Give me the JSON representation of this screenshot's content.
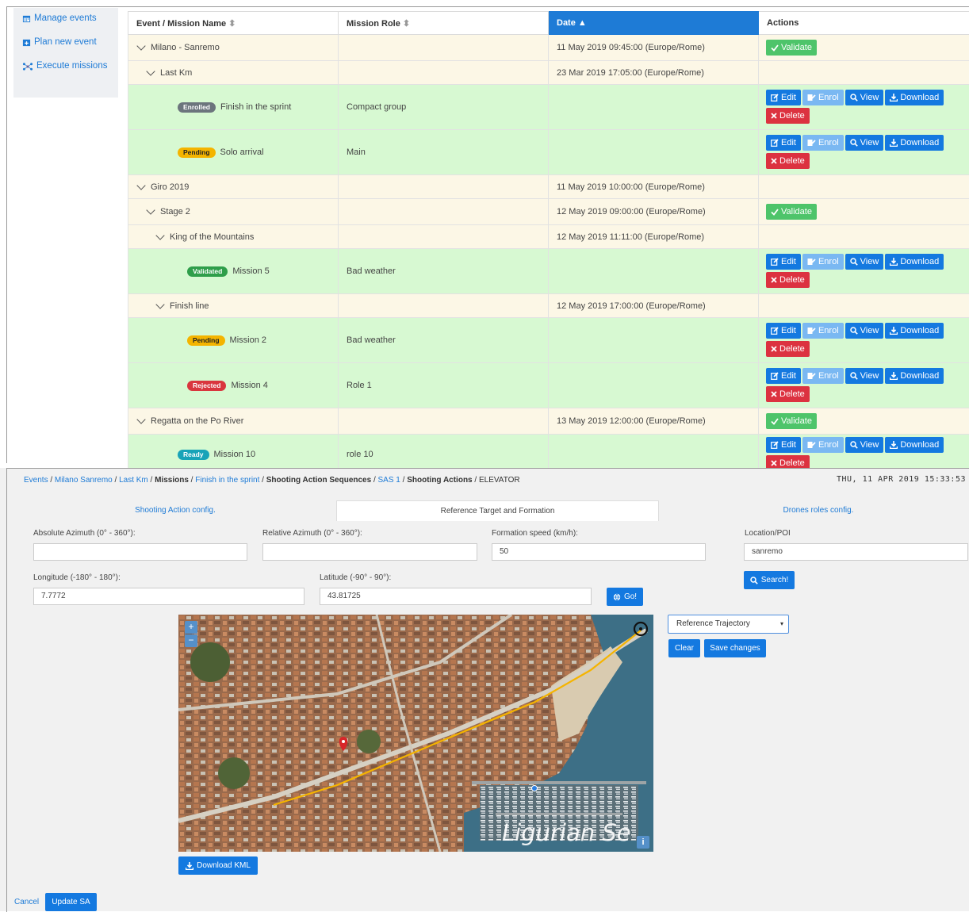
{
  "sidebar": {
    "items": [
      {
        "label": "Manage events",
        "icon": "calendar-icon"
      },
      {
        "label": "Plan new event",
        "icon": "calendar-plus-icon"
      },
      {
        "label": "Execute missions",
        "icon": "network-icon"
      }
    ]
  },
  "table": {
    "headers": [
      "Event / Mission Name",
      "Mission Role",
      "Date",
      "Actions"
    ],
    "sorted_column": "Date",
    "rows": [
      {
        "kind": "event",
        "indent": 0,
        "name": "Milano - Sanremo",
        "role": "",
        "date": "11 May 2019 09:45:00 (Europe/Rome)",
        "validate": true
      },
      {
        "kind": "event",
        "indent": 1,
        "name": "Last Km",
        "role": "",
        "date": "23 Mar 2019 17:05:00 (Europe/Rome)",
        "validate": false
      },
      {
        "kind": "mission",
        "indent": 2,
        "status": "Enrolled",
        "status_color": "grey",
        "name": "Finish in the sprint",
        "role": "Compact group",
        "date": ""
      },
      {
        "kind": "mission",
        "indent": 2,
        "status": "Pending",
        "status_color": "yellow",
        "name": "Solo arrival",
        "role": "Main",
        "date": ""
      },
      {
        "kind": "event",
        "indent": 0,
        "name": "Giro 2019",
        "role": "",
        "date": "11 May 2019 10:00:00 (Europe/Rome)",
        "validate": false
      },
      {
        "kind": "event",
        "indent": 1,
        "name": "Stage 2",
        "role": "",
        "date": "12 May 2019 09:00:00 (Europe/Rome)",
        "validate": true
      },
      {
        "kind": "event",
        "indent": 2,
        "name": "King of the Mountains",
        "role": "",
        "date": "12 May 2019 11:11:00 (Europe/Rome)",
        "validate": false
      },
      {
        "kind": "mission",
        "indent": 3,
        "status": "Validated",
        "status_color": "green",
        "name": "Mission 5",
        "role": "Bad weather",
        "date": ""
      },
      {
        "kind": "event",
        "indent": 2,
        "name": "Finish line",
        "role": "",
        "date": "12 May 2019 17:00:00 (Europe/Rome)",
        "validate": false
      },
      {
        "kind": "mission",
        "indent": 3,
        "status": "Pending",
        "status_color": "yellow",
        "name": "Mission 2",
        "role": "Bad weather",
        "date": ""
      },
      {
        "kind": "mission",
        "indent": 3,
        "status": "Rejected",
        "status_color": "red",
        "name": "Mission 4",
        "role": "Role 1",
        "date": ""
      },
      {
        "kind": "event",
        "indent": 0,
        "name": "Regatta on the Po River",
        "role": "",
        "date": "13 May 2019 12:00:00 (Europe/Rome)",
        "validate": true
      },
      {
        "kind": "mission",
        "indent": 2,
        "status": "Ready",
        "status_color": "teal",
        "name": "Mission 10",
        "role": "role 10",
        "date": ""
      }
    ],
    "actions": {
      "validate": "Validate",
      "edit": "Edit",
      "enrol": "Enrol",
      "view": "View",
      "download": "Download",
      "delete": "Delete"
    }
  },
  "breadcrumb": [
    {
      "text": "Events",
      "style": "link"
    },
    {
      "text": "Milano   Sanremo",
      "style": "link"
    },
    {
      "text": "Last Km",
      "style": "link"
    },
    {
      "text": "Missions",
      "style": "bold"
    },
    {
      "text": "Finish in the sprint",
      "style": "link"
    },
    {
      "text": "Shooting Action Sequences",
      "style": "bold"
    },
    {
      "text": "SAS 1",
      "style": "link"
    },
    {
      "text": "Shooting Actions",
      "style": "bold"
    },
    {
      "text": "ELEVATOR",
      "style": "plain"
    }
  ],
  "datetime": "THU, 11 APR 2019 15:33:53",
  "tabs": [
    {
      "label": "Shooting Action config.",
      "active": false
    },
    {
      "label": "Reference Target and Formation",
      "active": true
    },
    {
      "label": "Drones roles config.",
      "active": false
    }
  ],
  "form": {
    "abs_azimuth_label": "Absolute Azimuth (0° - 360°):",
    "abs_azimuth_value": "",
    "rel_azimuth_label": "Relative Azimuth (0° - 360°):",
    "rel_azimuth_value": "",
    "speed_label": "Formation speed (km/h):",
    "speed_value": "50",
    "location_label": "Location/POI",
    "location_value": "sanremo",
    "search_label": "Search!",
    "longitude_label": "Longitude (-180° - 180°):",
    "longitude_value": "7.7772",
    "latitude_label": "Latitude (-90° - 90°):",
    "latitude_value": "43.81725",
    "go_label": "Go!",
    "reference_select": "Reference Trajectory",
    "clear_label": "Clear",
    "save_label": "Save changes",
    "download_kml_label": "Download KML",
    "cancel_label": "Cancel",
    "update_label": "Update SA"
  },
  "map": {
    "watermark": "Ligurian Se",
    "zoom_in": "+",
    "zoom_out": "−",
    "info": "i",
    "route_color": "#f5b400",
    "pin_color": "#d8262a"
  }
}
